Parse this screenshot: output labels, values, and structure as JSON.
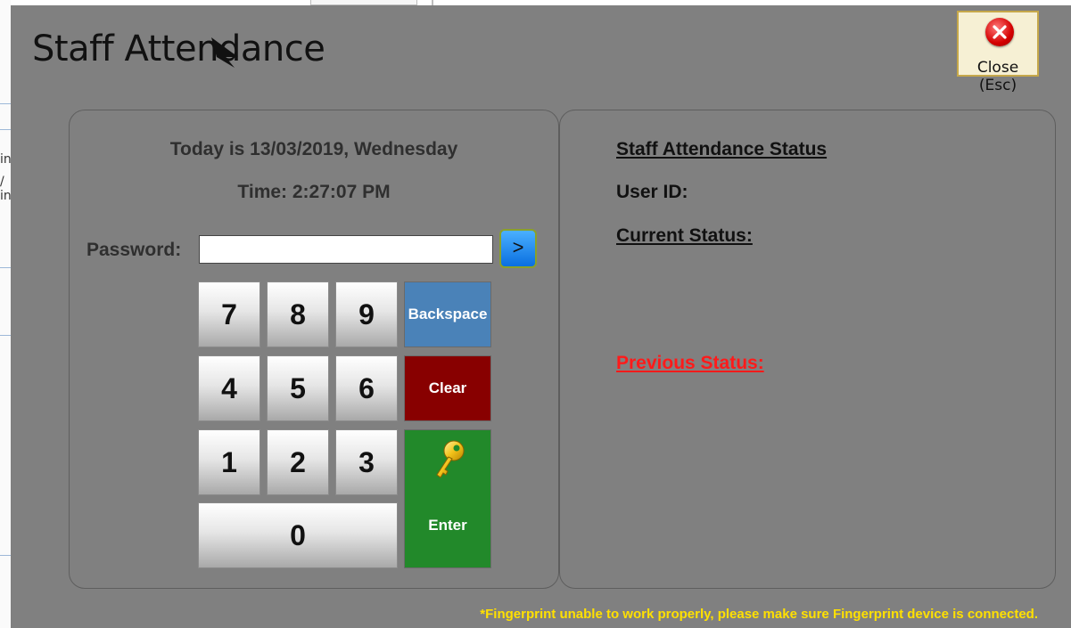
{
  "background": {
    "text_fragments": [
      "in",
      "/",
      "in"
    ]
  },
  "dialog": {
    "title": "Staff Attendance",
    "close_label": "Close (Esc)",
    "close_icon": "close-x-icon"
  },
  "left_panel": {
    "date_text": "Today is 13/03/2019, Wednesday",
    "time_text": "Time: 2:27:07 PM",
    "password_label": "Password:",
    "password_value": "",
    "go_label": ">",
    "keypad": {
      "keys": [
        "7",
        "8",
        "9",
        "4",
        "5",
        "6",
        "1",
        "2",
        "3",
        "0"
      ],
      "backspace_label": "Backspace",
      "clear_label": "Clear",
      "enter_label": "Enter",
      "enter_icon": "key-icon"
    }
  },
  "right_panel": {
    "status_title": "Staff Attendance Status",
    "user_id_label": "User ID:",
    "current_status_label": "Current Status:",
    "previous_status_label": "Previous Status:"
  },
  "footer": {
    "note": "*Fingerprint unable to work properly, please make sure Fingerprint device is connected."
  },
  "colors": {
    "dialog_bg": "#808080",
    "backspace": "#4a82b8",
    "clear": "#880000",
    "enter": "#22892a",
    "previous_status": "#ff1a1a",
    "footer_note": "#ffe000"
  }
}
